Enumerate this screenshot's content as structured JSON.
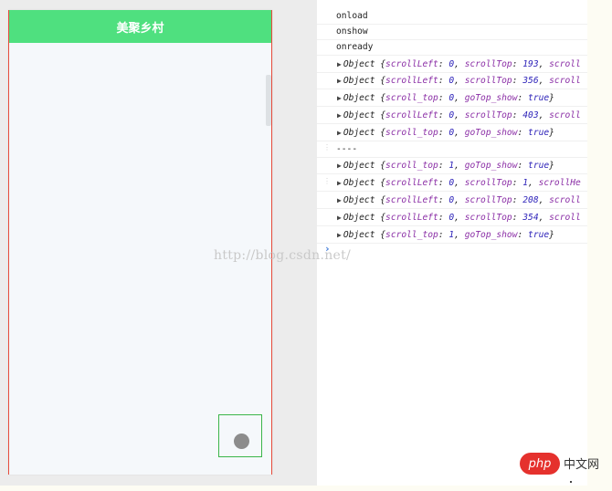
{
  "simulator": {
    "nav_title": "美聚乡村"
  },
  "console": {
    "lines": [
      {
        "kind": "plain",
        "text": "onload"
      },
      {
        "kind": "plain",
        "text": "onshow"
      },
      {
        "kind": "plain",
        "text": "onready"
      },
      {
        "kind": "object",
        "name": "Object",
        "parts": [
          [
            "k",
            "scrollLeft"
          ],
          [
            "p",
            ": "
          ],
          [
            "n",
            "0"
          ],
          [
            "p",
            ", "
          ],
          [
            "k",
            "scrollTop"
          ],
          [
            "p",
            ": "
          ],
          [
            "n",
            "193"
          ],
          [
            "p",
            ", "
          ],
          [
            "k",
            "scroll"
          ]
        ]
      },
      {
        "kind": "object",
        "name": "Object",
        "parts": [
          [
            "k",
            "scrollLeft"
          ],
          [
            "p",
            ": "
          ],
          [
            "n",
            "0"
          ],
          [
            "p",
            ", "
          ],
          [
            "k",
            "scrollTop"
          ],
          [
            "p",
            ": "
          ],
          [
            "n",
            "356"
          ],
          [
            "p",
            ", "
          ],
          [
            "k",
            "scroll"
          ]
        ]
      },
      {
        "kind": "object",
        "name": "Object",
        "parts": [
          [
            "k",
            "scroll_top"
          ],
          [
            "p",
            ": "
          ],
          [
            "n",
            "0"
          ],
          [
            "p",
            ", "
          ],
          [
            "k",
            "goTop_show"
          ],
          [
            "p",
            ": "
          ],
          [
            "n",
            "true"
          ],
          [
            "p",
            "}"
          ]
        ]
      },
      {
        "kind": "object",
        "name": "Object",
        "parts": [
          [
            "k",
            "scrollLeft"
          ],
          [
            "p",
            ": "
          ],
          [
            "n",
            "0"
          ],
          [
            "p",
            ", "
          ],
          [
            "k",
            "scrollTop"
          ],
          [
            "p",
            ": "
          ],
          [
            "n",
            "403"
          ],
          [
            "p",
            ", "
          ],
          [
            "k",
            "scroll"
          ]
        ]
      },
      {
        "kind": "object",
        "name": "Object",
        "parts": [
          [
            "k",
            "scroll_top"
          ],
          [
            "p",
            ": "
          ],
          [
            "n",
            "0"
          ],
          [
            "p",
            ", "
          ],
          [
            "k",
            "goTop_show"
          ],
          [
            "p",
            ": "
          ],
          [
            "n",
            "true"
          ],
          [
            "p",
            "}"
          ]
        ]
      },
      {
        "kind": "plain",
        "text": "----"
      },
      {
        "kind": "object",
        "name": "Object",
        "parts": [
          [
            "k",
            "scroll_top"
          ],
          [
            "p",
            ": "
          ],
          [
            "n",
            "1"
          ],
          [
            "p",
            ", "
          ],
          [
            "k",
            "goTop_show"
          ],
          [
            "p",
            ": "
          ],
          [
            "n",
            "true"
          ],
          [
            "p",
            "}"
          ]
        ]
      },
      {
        "kind": "object",
        "name": "Object",
        "parts": [
          [
            "k",
            "scrollLeft"
          ],
          [
            "p",
            ": "
          ],
          [
            "n",
            "0"
          ],
          [
            "p",
            ", "
          ],
          [
            "k",
            "scrollTop"
          ],
          [
            "p",
            ": "
          ],
          [
            "n",
            "1"
          ],
          [
            "p",
            ", "
          ],
          [
            "k",
            "scrollHe"
          ]
        ]
      },
      {
        "kind": "object",
        "name": "Object",
        "parts": [
          [
            "k",
            "scrollLeft"
          ],
          [
            "p",
            ": "
          ],
          [
            "n",
            "0"
          ],
          [
            "p",
            ", "
          ],
          [
            "k",
            "scrollTop"
          ],
          [
            "p",
            ": "
          ],
          [
            "n",
            "208"
          ],
          [
            "p",
            ", "
          ],
          [
            "k",
            "scroll"
          ]
        ]
      },
      {
        "kind": "object",
        "name": "Object",
        "parts": [
          [
            "k",
            "scrollLeft"
          ],
          [
            "p",
            ": "
          ],
          [
            "n",
            "0"
          ],
          [
            "p",
            ", "
          ],
          [
            "k",
            "scrollTop"
          ],
          [
            "p",
            ": "
          ],
          [
            "n",
            "354"
          ],
          [
            "p",
            ", "
          ],
          [
            "k",
            "scroll"
          ]
        ]
      },
      {
        "kind": "object",
        "name": "Object",
        "parts": [
          [
            "k",
            "scroll_top"
          ],
          [
            "p",
            ": "
          ],
          [
            "n",
            "1"
          ],
          [
            "p",
            ", "
          ],
          [
            "k",
            "goTop_show"
          ],
          [
            "p",
            ": "
          ],
          [
            "n",
            "true"
          ],
          [
            "p",
            "}"
          ]
        ]
      }
    ],
    "prompt_symbol": "›"
  },
  "watermark": "http://blog.csdn.net/",
  "badge": {
    "logo_text": "php",
    "site_text": "中文网"
  },
  "colors": {
    "nav_green": "#4fe07f",
    "phone_border": "#e74c3c",
    "gotop_border": "#3bb54a",
    "console_key": "#8b2fa6",
    "console_value": "#2a1fb8",
    "php_red": "#e5312d"
  }
}
